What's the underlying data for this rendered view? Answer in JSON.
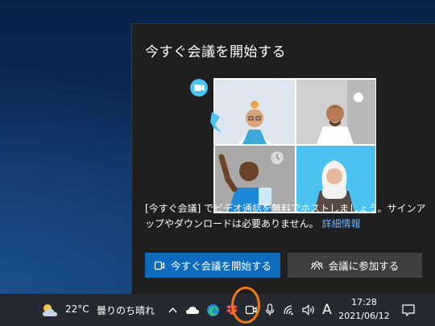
{
  "popup": {
    "title": "今すぐ会議を開始する",
    "description": "[今すぐ会議] でビデオ通話を無料でホストしましょう。サインアップやダウンロードは必要ありません。",
    "link_text": "詳細情報",
    "start_button": "今すぐ会議を開始する",
    "join_button": "会議に参加する"
  },
  "taskbar": {
    "temperature": "22°C",
    "weather_condition": "曇りのち晴れ",
    "time": "17:28",
    "date": "2021/06/12",
    "ime_indicator": "A"
  },
  "icons": {
    "weather": "partly-cloudy-icon",
    "chevron": "chevron-up-icon",
    "onedrive": "cloud-icon",
    "edge": "edge-browser-icon",
    "dropbox": "dropbox-icon",
    "meet_now": "meet-now-icon",
    "microphone": "microphone-icon",
    "network": "wifi-icon",
    "volume": "speaker-icon",
    "notifications": "notification-icon"
  },
  "colors": {
    "accent": "#0f6cbd",
    "link": "#6cb4ff",
    "highlight": "#f07a12",
    "panel_bg": "#1f1f1f",
    "taskbar_bg": "#262a30"
  }
}
